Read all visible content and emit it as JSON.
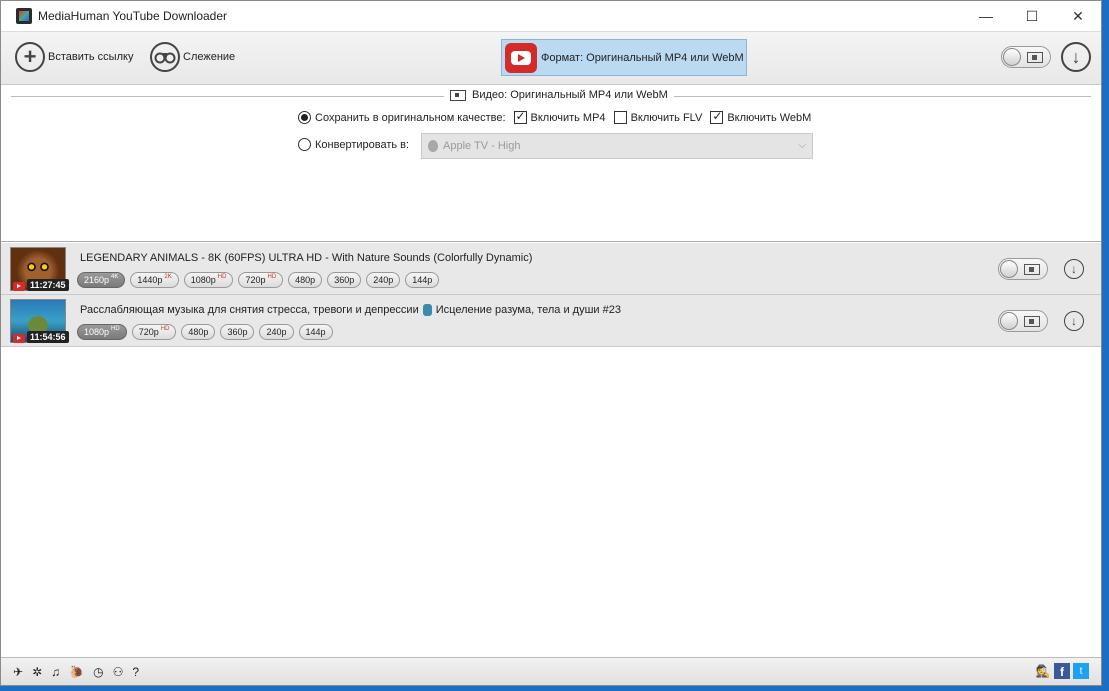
{
  "window": {
    "title": "MediaHuman YouTube Downloader",
    "minimize": "—",
    "maximize": "☐",
    "close": "✕"
  },
  "toolbar": {
    "paste_link_icon": "+",
    "paste_link_label": "Вставить ссылку",
    "tracking_label": "Слежение",
    "format_label": "Формат: Оригинальный MP4 или WebM",
    "download_icon": "↓"
  },
  "settings": {
    "section_title": "Видео: Оригинальный MP4 или WebM",
    "save_original_label": "Сохранить в оригинальном качестве:",
    "include_mp4_label": "Включить MP4",
    "include_flv_label": "Включить FLV",
    "include_webm_label": "Включить WebM",
    "convert_label": "Конвертировать в:",
    "convert_target": "Apple TV - High",
    "convert_caret": "⌵"
  },
  "items": [
    {
      "title": "LEGENDARY ANIMALS - 8K (60FPS) ULTRA HD - With Nature Sounds (Colorfully Dynamic)",
      "duration": "11:27:45",
      "chips": [
        {
          "label": "2160p",
          "tag": "4K"
        },
        {
          "label": "1440p",
          "tag": "2K"
        },
        {
          "label": "1080p",
          "tag": "HD"
        },
        {
          "label": "720p",
          "tag": "HD"
        },
        {
          "label": "480p",
          "tag": ""
        },
        {
          "label": "360p",
          "tag": ""
        },
        {
          "label": "240p",
          "tag": ""
        },
        {
          "label": "144p",
          "tag": ""
        }
      ]
    },
    {
      "title": "Расслабляющая музыка для снятия стресса, тревоги и депрессии",
      "title_suffix": "Исцеление разума, тела и души #23",
      "duration": "11:54:56",
      "chips": [
        {
          "label": "1080p",
          "tag": "HD"
        },
        {
          "label": "720p",
          "tag": "HD"
        },
        {
          "label": "480p",
          "tag": ""
        },
        {
          "label": "360p",
          "tag": ""
        },
        {
          "label": "240p",
          "tag": ""
        },
        {
          "label": "144p",
          "tag": ""
        }
      ]
    }
  ],
  "statusbar": {
    "icons": [
      "✈",
      "✲",
      "♫",
      "🐌",
      "◷",
      "⚇",
      "?"
    ],
    "facebook": "f",
    "twitter": "t",
    "spy": "🕵"
  }
}
